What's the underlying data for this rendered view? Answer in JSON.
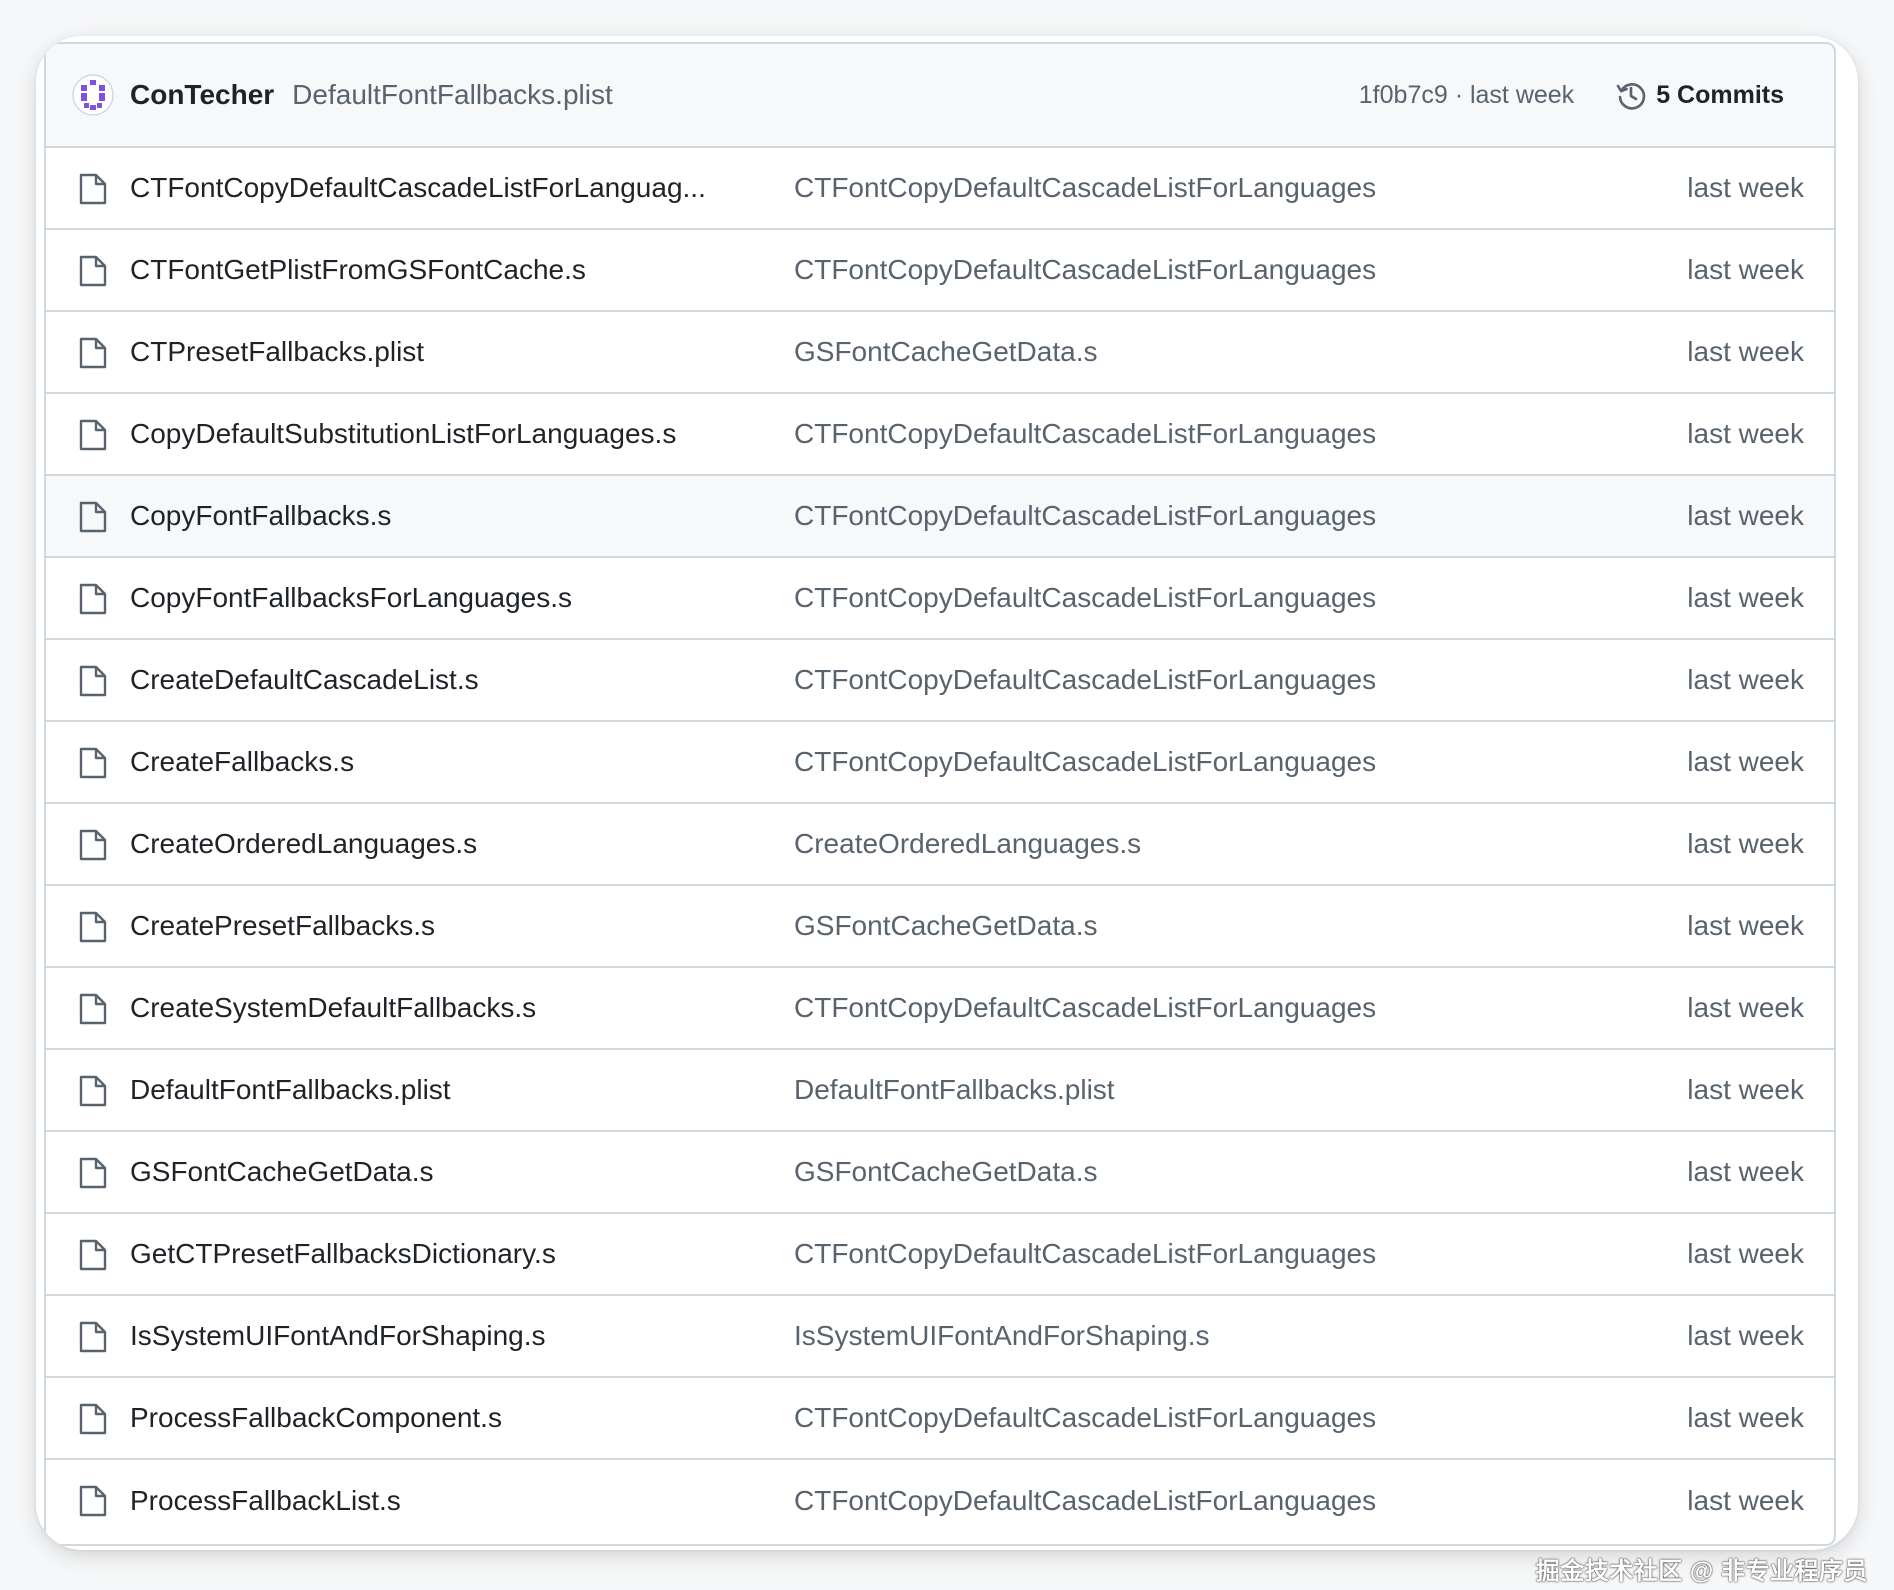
{
  "header": {
    "avatar_icon": "octicon-identicon-avatar",
    "owner": "ConTecher",
    "commit_message": "DefaultFontFallbacks.plist",
    "commit_meta": "1f0b7c9 · last week",
    "commits_icon": "history-icon",
    "commits_label": "5 Commits"
  },
  "files": [
    {
      "name": "CTFontCopyDefaultCascadeListForLanguag...",
      "commit": "CTFontCopyDefaultCascadeListForLanguages",
      "date": "last week"
    },
    {
      "name": "CTFontGetPlistFromGSFontCache.s",
      "commit": "CTFontCopyDefaultCascadeListForLanguages",
      "date": "last week"
    },
    {
      "name": "CTPresetFallbacks.plist",
      "commit": "GSFontCacheGetData.s",
      "date": "last week"
    },
    {
      "name": "CopyDefaultSubstitutionListForLanguages.s",
      "commit": "CTFontCopyDefaultCascadeListForLanguages",
      "date": "last week"
    },
    {
      "name": "CopyFontFallbacks.s",
      "commit": "CTFontCopyDefaultCascadeListForLanguages",
      "date": "last week"
    },
    {
      "name": "CopyFontFallbacksForLanguages.s",
      "commit": "CTFontCopyDefaultCascadeListForLanguages",
      "date": "last week"
    },
    {
      "name": "CreateDefaultCascadeList.s",
      "commit": "CTFontCopyDefaultCascadeListForLanguages",
      "date": "last week"
    },
    {
      "name": "CreateFallbacks.s",
      "commit": "CTFontCopyDefaultCascadeListForLanguages",
      "date": "last week"
    },
    {
      "name": "CreateOrderedLanguages.s",
      "commit": "CreateOrderedLanguages.s",
      "date": "last week"
    },
    {
      "name": "CreatePresetFallbacks.s",
      "commit": "GSFontCacheGetData.s",
      "date": "last week"
    },
    {
      "name": "CreateSystemDefaultFallbacks.s",
      "commit": "CTFontCopyDefaultCascadeListForLanguages",
      "date": "last week"
    },
    {
      "name": "DefaultFontFallbacks.plist",
      "commit": "DefaultFontFallbacks.plist",
      "date": "last week"
    },
    {
      "name": "GSFontCacheGetData.s",
      "commit": "GSFontCacheGetData.s",
      "date": "last week"
    },
    {
      "name": "GetCTPresetFallbacksDictionary.s",
      "commit": "CTFontCopyDefaultCascadeListForLanguages",
      "date": "last week"
    },
    {
      "name": "IsSystemUIFontAndForShaping.s",
      "commit": "IsSystemUIFontAndForShaping.s",
      "date": "last week"
    },
    {
      "name": "ProcessFallbackComponent.s",
      "commit": "CTFontCopyDefaultCascadeListForLanguages",
      "date": "last week"
    },
    {
      "name": "ProcessFallbackList.s",
      "commit": "CTFontCopyDefaultCascadeListForLanguages",
      "date": "last week"
    }
  ],
  "file_icon": "file-icon",
  "hover_row_index": 4,
  "watermark": "掘金技术社区 @ 非专业程序员",
  "colors": {
    "text_primary": "#1f2328",
    "text_muted": "#59636e",
    "border": "#d1d9e0",
    "header_bg": "#f6f8fa",
    "avatar_purple": "#8250df"
  }
}
